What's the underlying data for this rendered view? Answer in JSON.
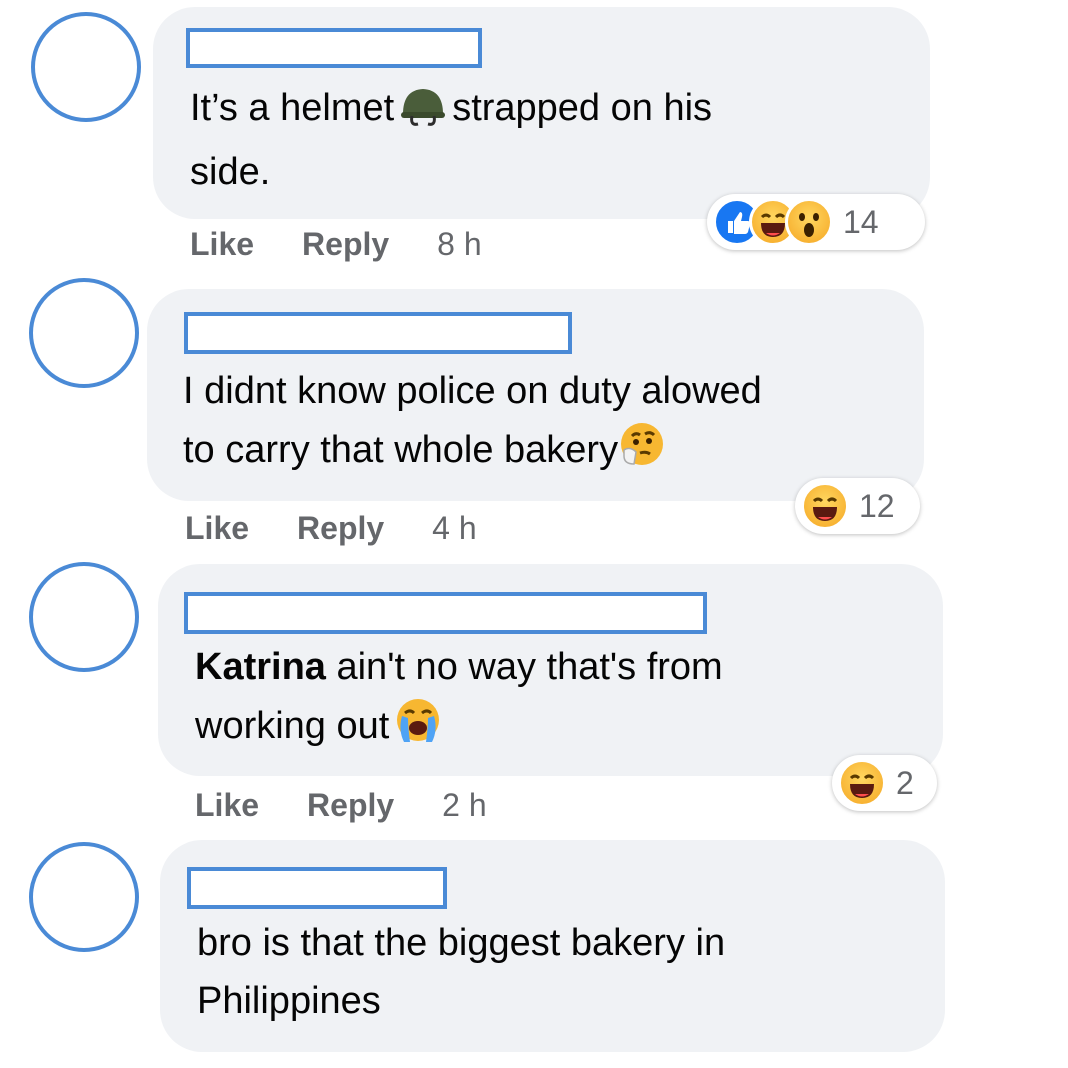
{
  "comments": [
    {
      "mention": "",
      "text_line1": "It’s a helmet",
      "emoji1": "helmet-emoji",
      "text_line1b": "strapped on his",
      "text_line2": "side.",
      "like": "Like",
      "reply": "Reply",
      "time": "8 h",
      "reaction_count": "14",
      "reactions": [
        "like",
        "haha",
        "wow"
      ]
    },
    {
      "text_line1": "I didnt know police on duty alowed",
      "text_line2": "to carry that whole bakery",
      "emoji1": "thinking-emoji",
      "like": "Like",
      "reply": "Reply",
      "time": "4 h",
      "reaction_count": "12",
      "reactions": [
        "haha"
      ]
    },
    {
      "mention": "Katrina",
      "text_line1": " ain't no way that's from",
      "text_line2": "working out",
      "emoji1": "crying-emoji",
      "like": "Like",
      "reply": "Reply",
      "time": "2 h",
      "reaction_count": "2",
      "reactions": [
        "haha"
      ]
    },
    {
      "text_line1": "bro is that the biggest bakery in",
      "text_line2": "Philippines"
    }
  ],
  "colors": {
    "avatar_border": "#4a8ad6",
    "bubble_bg": "#f0f2f5",
    "like_blue": "#1877f2",
    "secondary_text": "#65676b"
  }
}
